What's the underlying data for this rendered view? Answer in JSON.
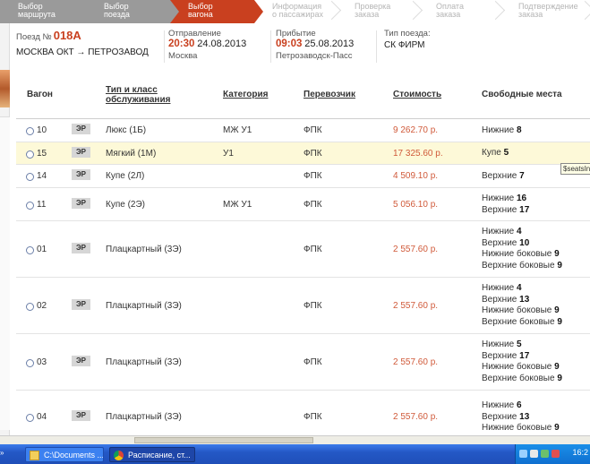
{
  "steps": [
    {
      "label": "Выбор\nмаршрута",
      "state": "done"
    },
    {
      "label": "Выбор\nпоезда",
      "state": "done"
    },
    {
      "label": "Выбор\nвагона",
      "state": "active"
    },
    {
      "label": "Информация\nо пассажирах",
      "state": "todo"
    },
    {
      "label": "Проверка\nзаказа",
      "state": "todo"
    },
    {
      "label": "Оплата\nзаказа",
      "state": "todo"
    },
    {
      "label": "Подтверждение\nзаказа",
      "state": "todo"
    }
  ],
  "train": {
    "no_label": "Поезд №",
    "number": "018А",
    "route": "МОСКВА ОКТ → ПЕТРОЗАВОД",
    "departure_label": "Отправление",
    "departure_time": "20:30",
    "departure_date": "24.08.2013",
    "departure_station": "Москва",
    "arrival_label": "Прибытие",
    "arrival_time": "09:03",
    "arrival_date": "25.08.2013",
    "arrival_station": "Петрозаводск-Пасс",
    "type_label": "Тип поезда:",
    "type_value": "СК ФИРМ"
  },
  "table": {
    "headers": {
      "wagon": "Вагон",
      "type": "Тип и класс\nобслуживания",
      "category": "Категория",
      "carrier": "Перевозчик",
      "price": "Стоимость",
      "seats": "Свободные места"
    },
    "rows": [
      {
        "wagon": "10",
        "badge": "ЭР",
        "type": "Люкс (1Б)",
        "category": "МЖ У1",
        "carrier": "ФПК",
        "price": "9 262.70 р.",
        "seats": [
          [
            "Нижние",
            "8"
          ]
        ]
      },
      {
        "wagon": "15",
        "badge": "ЭР",
        "type": "Мягкий (1М)",
        "category": "У1",
        "carrier": "ФПК",
        "price": "17 325.60 р.",
        "seats": [
          [
            "Купе",
            "5"
          ]
        ],
        "highlight": true
      },
      {
        "wagon": "14",
        "badge": "ЭР",
        "type": "Купе (2Л)",
        "category": "",
        "carrier": "ФПК",
        "price": "4 509.10 р.",
        "seats": [
          [
            "Верхние",
            "7"
          ]
        ]
      },
      {
        "wagon": "11",
        "badge": "ЭР",
        "type": "Купе (2Э)",
        "category": "МЖ У1",
        "carrier": "ФПК",
        "price": "5 056.10 р.",
        "seats": [
          [
            "Нижние",
            "16"
          ],
          [
            "Верхние",
            "17"
          ]
        ]
      },
      {
        "wagon": "01",
        "badge": "ЭР",
        "type": "Плацкартный (3Э)",
        "category": "",
        "carrier": "ФПК",
        "price": "2 557.60 р.",
        "seats": [
          [
            "Нижние",
            "4"
          ],
          [
            "Верхние",
            "10"
          ],
          [
            "Нижние боковые",
            "9"
          ],
          [
            "Верхние боковые",
            "9"
          ]
        ]
      },
      {
        "wagon": "02",
        "badge": "ЭР",
        "type": "Плацкартный (3Э)",
        "category": "",
        "carrier": "ФПК",
        "price": "2 557.60 р.",
        "seats": [
          [
            "Нижние",
            "4"
          ],
          [
            "Верхние",
            "13"
          ],
          [
            "Нижние боковые",
            "9"
          ],
          [
            "Верхние боковые",
            "9"
          ]
        ]
      },
      {
        "wagon": "03",
        "badge": "ЭР",
        "type": "Плацкартный (3Э)",
        "category": "",
        "carrier": "ФПК",
        "price": "2 557.60 р.",
        "seats": [
          [
            "Нижние",
            "5"
          ],
          [
            "Верхние",
            "17"
          ],
          [
            "Нижние боковые",
            "9"
          ],
          [
            "Верхние боковые",
            "9"
          ]
        ]
      },
      {
        "wagon": "04",
        "badge": "ЭР",
        "type": "Плацкартный (3Э)",
        "category": "",
        "carrier": "ФПК",
        "price": "2 557.60 р.",
        "seats": [
          [
            "Нижние",
            "6"
          ],
          [
            "Верхние",
            "13"
          ],
          [
            "Нижние боковые",
            "9"
          ]
        ]
      }
    ]
  },
  "tooltip": "$seatsIn",
  "taskbar": {
    "item1": "C:\\Documents ...",
    "item2": "Расписание, ст...",
    "clock": "16:2"
  },
  "colors": {
    "accent": "#c9401f",
    "price": "#d05a3a",
    "highlight_row": "#fdf9d8",
    "step_done": "#9a9a9a"
  }
}
